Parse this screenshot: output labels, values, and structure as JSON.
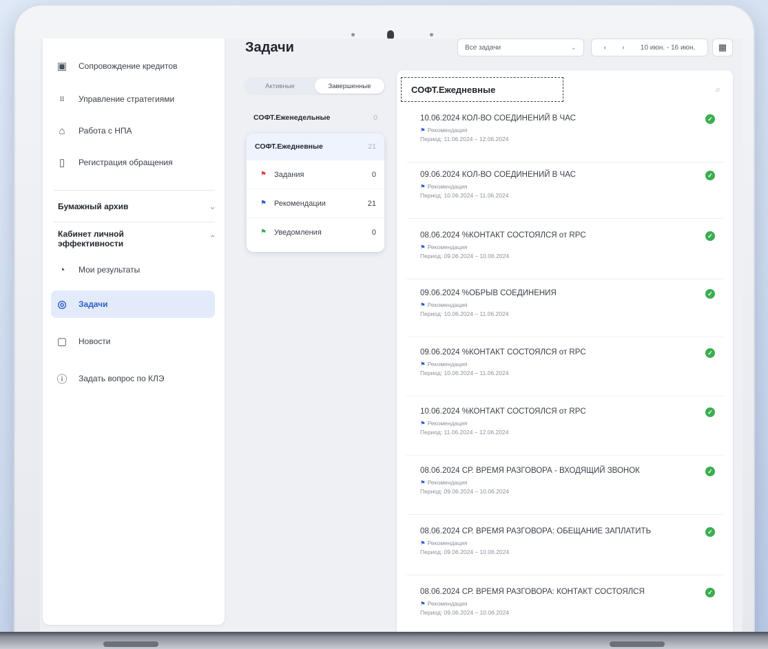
{
  "sidebar": {
    "items": [
      {
        "label": "Сопровождение кредитов",
        "icon": "credit-icon"
      },
      {
        "label": "Управление стратегиями",
        "icon": "strategy-icon"
      },
      {
        "label": "Работа с НПА",
        "icon": "building-icon"
      },
      {
        "label": "Регистрация обращения",
        "icon": "document-alert-icon"
      }
    ],
    "sections": [
      {
        "label": "Бумажный архив",
        "state": "collapsed"
      },
      {
        "label": "Кабинет личной эффективности",
        "state": "expanded"
      }
    ],
    "sub_items": [
      {
        "label": "Мои результаты",
        "icon": "chart-icon"
      },
      {
        "label": "Задачи",
        "icon": "task-icon",
        "active": true
      },
      {
        "label": "Новости",
        "icon": "news-icon"
      },
      {
        "label": "Задать вопрос по КЛЭ",
        "icon": "question-icon"
      }
    ]
  },
  "header": {
    "title": "Задачи",
    "filter": "Все задачи",
    "date_range": "10 июн. - 16 июн."
  },
  "toggle": {
    "active": "Активные",
    "completed": "Завершенные"
  },
  "categories": {
    "weekly": {
      "label": "СОФТ.Еженедельные",
      "count": "0"
    },
    "daily": {
      "label": "СОФТ.Ежедневные",
      "count": "21"
    },
    "subs": [
      {
        "label": "Задания",
        "count": "0",
        "color": "#e23b4a"
      },
      {
        "label": "Рекомендации",
        "count": "21",
        "color": "#2b5fcc"
      },
      {
        "label": "Уведомления",
        "count": "0",
        "color": "#3bae4f"
      }
    ]
  },
  "panel": {
    "title": "СОФТ.Ежедневные",
    "type_label": "Рекомендация",
    "tasks": [
      {
        "title": "10.06.2024 КОЛ-ВО СОЕДИНЕНИЙ В ЧАС",
        "period": "Период: 11.06.2024 – 12.06.2024"
      },
      {
        "title": "09.06.2024 КОЛ-ВО СОЕДИНЕНИЙ В ЧАС",
        "period": "Период: 10.06.2024 – 11.06.2024"
      },
      {
        "title": "08.06.2024 %КОНТАКТ СОСТОЯЛСЯ от RPC",
        "period": "Период: 09.06.2024 – 10.06.2024"
      },
      {
        "title": "09.06.2024 %ОБРЫВ СОЕДИНЕНИЯ",
        "period": "Период: 10.06.2024 – 11.06.2024"
      },
      {
        "title": "09.06.2024 %КОНТАКТ СОСТОЯЛСЯ от RPC",
        "period": "Период: 10.06.2024 – 11.06.2024"
      },
      {
        "title": "10.06.2024 %КОНТАКТ СОСТОЯЛСЯ от RPC",
        "period": "Период: 11.06.2024 – 12.06.2024"
      },
      {
        "title": "08.06.2024 СР. ВРЕМЯ РАЗГОВОРА - ВХОДЯЩИЙ ЗВОНОК",
        "period": "Период: 09.06.2024 – 10.06.2024"
      },
      {
        "title": "08.06.2024 СР. ВРЕМЯ РАЗГОВОРА: ОБЕЩАНИЕ ЗАПЛАТИТЬ",
        "period": "Период: 09.06.2024 – 10.06.2024"
      },
      {
        "title": "08.06.2024 СР. ВРЕМЯ РАЗГОВОРА: КОНТАКТ СОСТОЯЛСЯ",
        "period": "Период: 09.06.2024 – 10.06.2024"
      }
    ]
  }
}
